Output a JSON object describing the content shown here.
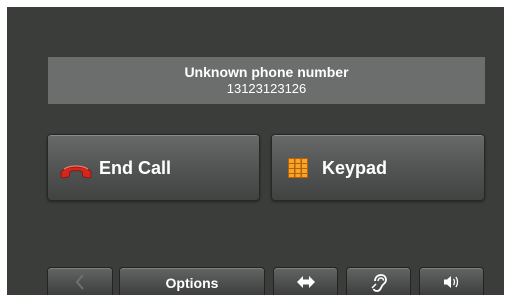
{
  "call": {
    "caller_name": "Unknown phone number",
    "caller_number": "13123123126"
  },
  "actions": {
    "end_call_label": "End Call",
    "end_call_icon": "hang-up-icon",
    "keypad_label": "Keypad",
    "keypad_icon": "keypad-grid-icon"
  },
  "bottom_bar": {
    "back_icon": "chevron-left-icon",
    "options_label": "Options",
    "transfer_icon": "left-right-arrows-icon",
    "hearing_icon": "ear-icon",
    "volume_icon": "speaker-volume-icon"
  },
  "colors": {
    "screen_background": "#3a3d3a",
    "banner_background": "#6c6e6d",
    "hang_up_red": "#d4261c",
    "keypad_orange": "#e8941a",
    "text": "#ffffff"
  }
}
